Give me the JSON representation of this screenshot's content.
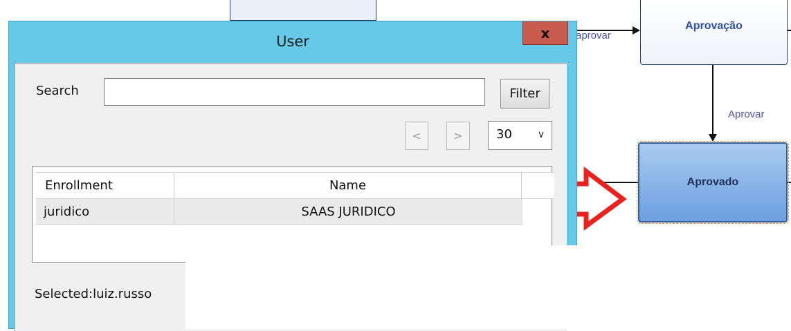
{
  "workflow": {
    "nodes": {
      "aprovacao": "Aprovação",
      "aprovado": "Aprovado"
    },
    "edges": {
      "aprovar_top": "aprovar",
      "aprovar_down": "Aprovar"
    },
    "colors": {
      "arrow_highlight": "#e8231f"
    }
  },
  "dialog": {
    "title": "User",
    "close_label": "x",
    "search": {
      "label": "Search",
      "value": "",
      "filter_label": "Filter"
    },
    "pager": {
      "prev": "<",
      "next": ">",
      "page_size": "30"
    },
    "grid": {
      "columns": [
        "Enrollment",
        "Name"
      ],
      "rows": [
        {
          "enrollment": "juridico",
          "name": "SAAS JURIDICO"
        }
      ]
    },
    "status": {
      "selected": "Selected:luiz.russo"
    }
  },
  "icons": [
    "close-icon",
    "chevron-down-icon",
    "arrow-left-icon",
    "arrow-right-icon"
  ]
}
